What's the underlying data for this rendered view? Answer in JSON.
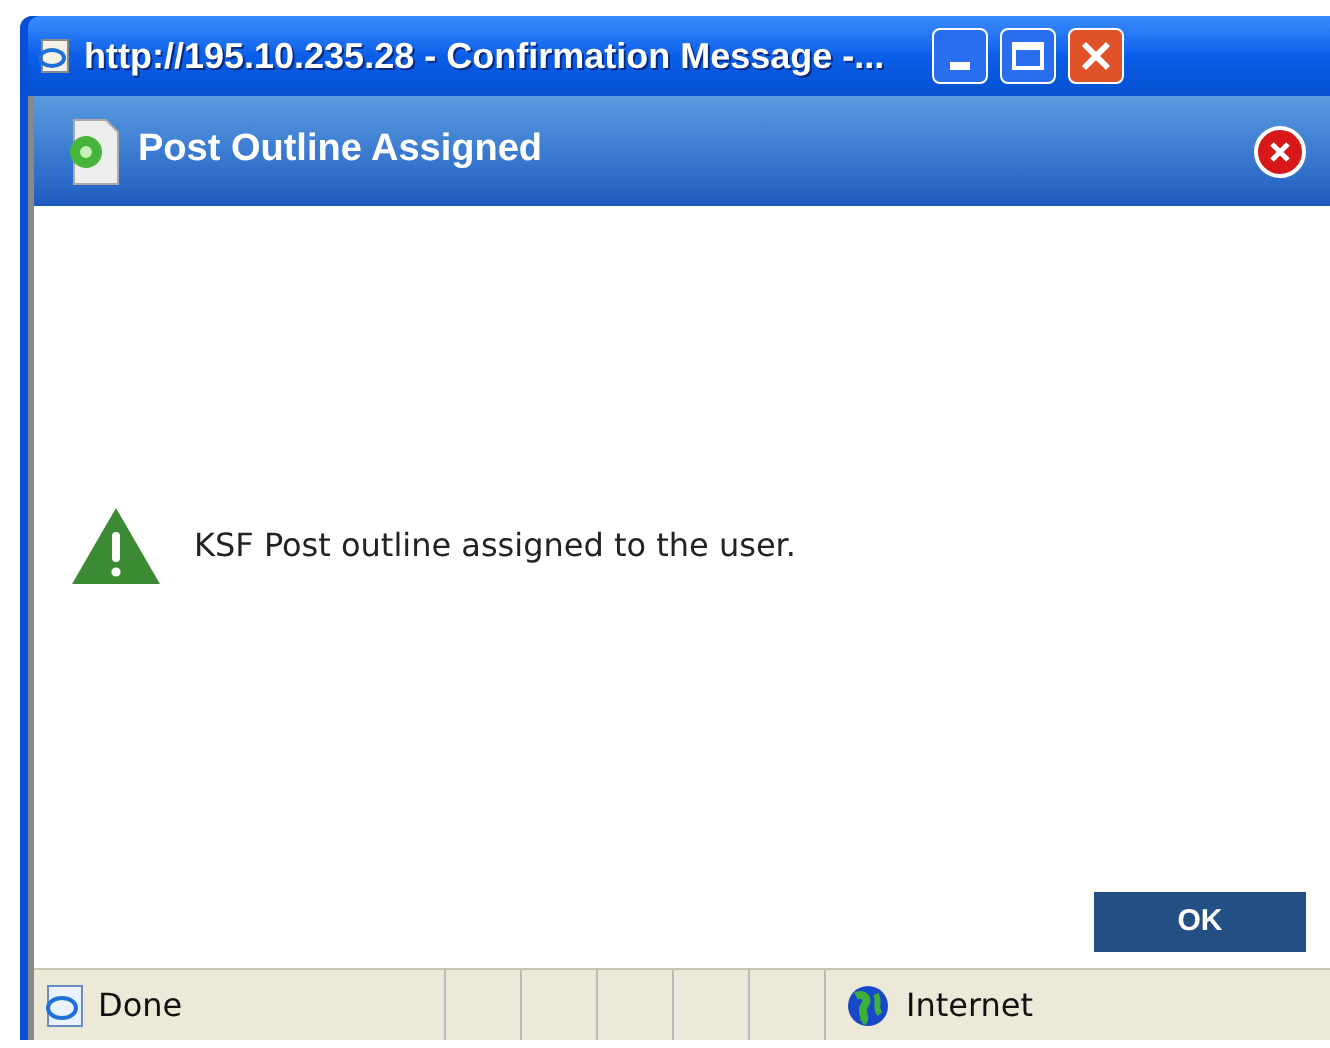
{
  "window": {
    "title": "http://195.10.235.28 - Confirmation Message -..."
  },
  "dialog": {
    "title": "Post Outline Assigned",
    "message": "KSF Post outline assigned to the user.",
    "buttons": [
      "OK"
    ]
  },
  "status_bar": {
    "status": "Done",
    "zone": "Internet"
  }
}
